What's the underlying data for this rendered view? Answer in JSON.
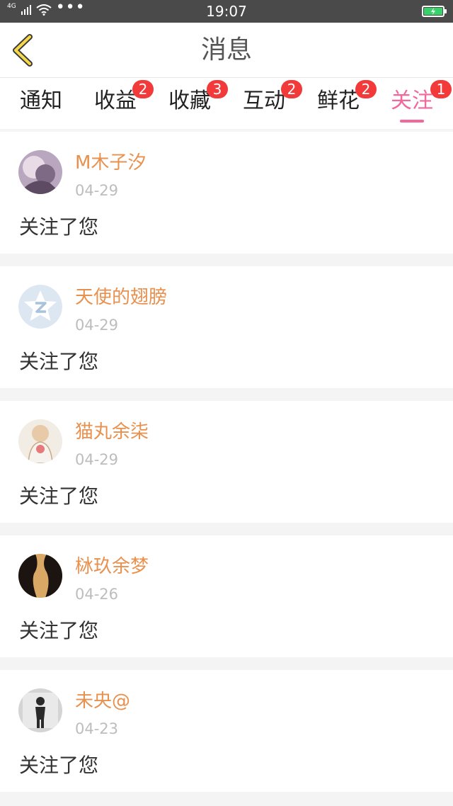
{
  "status_bar": {
    "network": "4G",
    "dots": "•••",
    "time": "19:07"
  },
  "header": {
    "title": "消息",
    "back_icon": "chevron-left-icon"
  },
  "tabs": [
    {
      "label": "通知",
      "badge": ""
    },
    {
      "label": "收益",
      "badge": "2"
    },
    {
      "label": "收藏",
      "badge": "3"
    },
    {
      "label": "互动",
      "badge": "2"
    },
    {
      "label": "鲜花",
      "badge": "2"
    },
    {
      "label": "关注",
      "badge": "1",
      "active": true
    }
  ],
  "colors": {
    "accent": "#f2679c",
    "name": "#e8914f",
    "badge": "#f23a3a"
  },
  "messages": [
    {
      "name": "M木子汐",
      "date": "04-29",
      "text": "关注了您"
    },
    {
      "name": "天使的翅膀",
      "date": "04-29",
      "text": "关注了您"
    },
    {
      "name": "猫丸余柒",
      "date": "04-29",
      "text": "关注了您"
    },
    {
      "name": "栤玖余梦",
      "date": "04-26",
      "text": "关注了您"
    },
    {
      "name": "未央@",
      "date": "04-23",
      "text": "关注了您"
    }
  ]
}
